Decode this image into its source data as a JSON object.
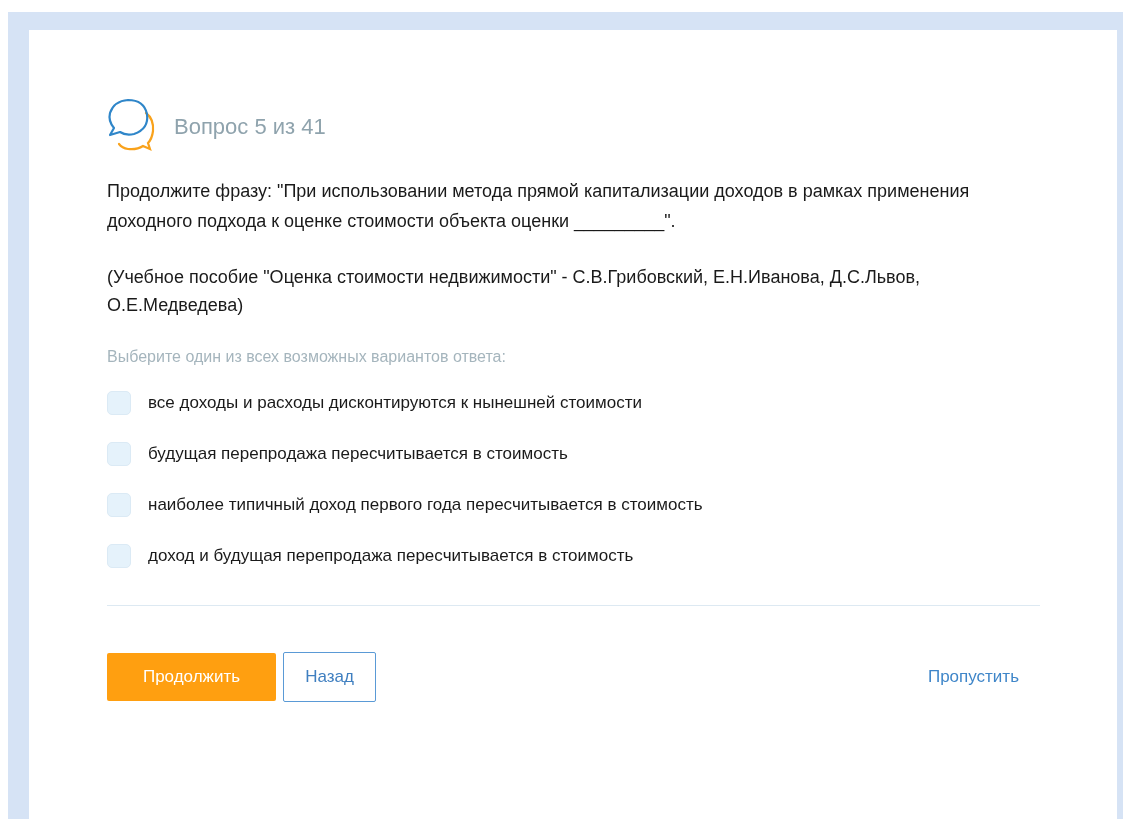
{
  "header": {
    "counter": "Вопрос 5 из 41"
  },
  "question": {
    "text": "Продолжите фразу: \"При использовании метода прямой капитализации доходов в рамках применения доходного подхода к оценке стоимости объекта оценки _________\".",
    "source": "(Учебное пособие \"Оценка стоимости недвижимости\" - С.В.Грибовский, Е.Н.Иванова, Д.С.Львов, О.Е.Медведева)"
  },
  "instruction": "Выберите один из всех возможных вариантов ответа:",
  "options": [
    {
      "label": "все доходы и расходы дисконтируются к нынешней стоимости",
      "checked": false
    },
    {
      "label": "будущая перепродажа пересчитывается в стоимость",
      "checked": false
    },
    {
      "label": "наиболее типичный доход первого года пересчитывается в стоимость",
      "checked": false
    },
    {
      "label": "доход и будущая перепродажа пересчитывается в стоимость",
      "checked": false
    }
  ],
  "buttons": {
    "continue": "Продолжить",
    "back": "Назад",
    "skip": "Пропустить"
  }
}
